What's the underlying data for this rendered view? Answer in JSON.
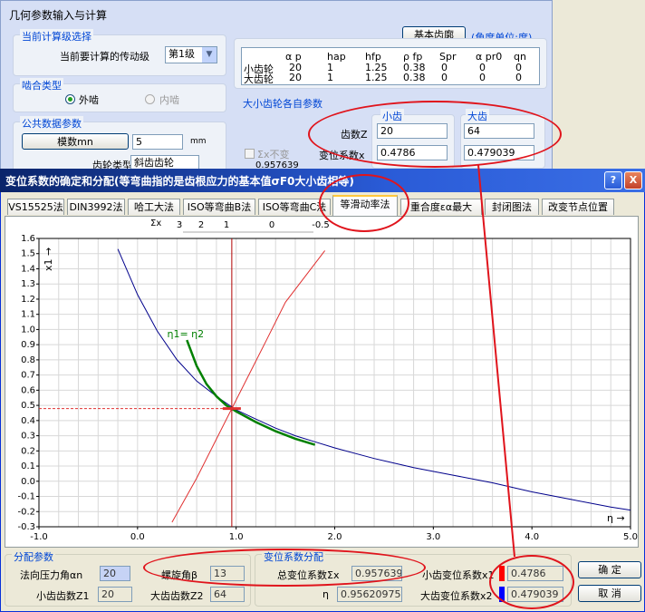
{
  "bg_window": {
    "title": "几何参数输入与计算",
    "current_stage_group": "当前计算级选择",
    "current_stage_label": "当前要计算的传动级",
    "current_stage_value": "第1级",
    "base_rack_button": "基本齿廓",
    "angle_unit": "(角度单位:度)",
    "rack_table": {
      "headers": [
        "α p",
        "hap",
        "hfp",
        "ρ fp",
        "Spr",
        "α pr0",
        "qn"
      ],
      "rows": [
        {
          "name": "小齿轮",
          "values": [
            "20",
            "1",
            "1.25",
            "0.38",
            "0",
            "0",
            "0"
          ]
        },
        {
          "name": "大齿轮",
          "values": [
            "20",
            "1",
            "1.25",
            "0.38",
            "0",
            "0",
            "0"
          ]
        }
      ]
    },
    "mesh_group": "啮合类型",
    "mesh_external": "外啮",
    "mesh_internal": "内啮",
    "common_group": "公共数据参数",
    "module_button": "模数mn",
    "module_value": "5",
    "module_unit": "mm",
    "gear_type_label": "齿轮类型",
    "gear_type_value": "斜齿齿轮",
    "gear_params_group": "大小齿轮各自参数",
    "small_gear": "小齿",
    "large_gear": "大齿",
    "teeth_label": "齿数Z",
    "teeth_small": "20",
    "teeth_large": "64",
    "shift_label": "变位系数x",
    "shift_small": "0.4786",
    "shift_large": "0.479039",
    "sum_not_change": "Σx不变",
    "sum_value": "0.957639"
  },
  "dialog": {
    "title": "变位系数的确定和分配(等弯曲指的是齿根应力的基本值σF0大小齿相等)",
    "help_button": "?",
    "close_button": "X",
    "tabs": [
      "VS15525法",
      "DIN3992法",
      "哈工大法",
      "ISO等弯曲B法",
      "ISO等弯曲C法",
      "等滑动率法",
      "重合度εα最大",
      "封闭图法",
      "改变节点位置"
    ],
    "active_tab": 5,
    "footer": {
      "dist_group": "分配参数",
      "pressure_angle_label": "法向压力角αn",
      "pressure_angle": "20",
      "helix_label": "螺旋角β",
      "helix": "13",
      "z1_label": "小齿齿数Z1",
      "z1": "20",
      "z2_label": "大齿齿数Z2",
      "z2": "64",
      "shift_group": "变位系数分配",
      "total_shift_label": "总变位系数Σx",
      "total_shift": "0.957639",
      "eta_label": "η",
      "eta": "0.956209757",
      "x1_label": "小齿变位系数x1",
      "x1": "0.4786",
      "x2_label": "大齿变位系数x2",
      "x2": "0.479039",
      "ok_button": "确  定",
      "cancel_button": "取  消"
    }
  },
  "chart_data": {
    "type": "line",
    "xlim": [
      -1.0,
      5.0
    ],
    "ylim": [
      -0.3,
      1.6
    ],
    "x_ticks": [
      "-1.0",
      "0.0",
      "1.0",
      "2.0",
      "3.0",
      "4.0",
      "5.0"
    ],
    "y_ticks": [
      "1.6",
      "1.5",
      "1.4",
      "1.3",
      "1.2",
      "1.1",
      "1.0",
      "0.9",
      "0.8",
      "0.7",
      "0.6",
      "0.5",
      "0.4",
      "0.3",
      "0.2",
      "0.1",
      "0.0",
      "-0.1",
      "-0.2",
      "-0.3"
    ],
    "xlabel": "η",
    "ylabel": "x1",
    "sum_axis_label": "Σx",
    "sum_axis_ticks": [
      "3",
      "2",
      "1",
      "0",
      "-0.5"
    ],
    "grid": true,
    "curve_annotation": "η1= η2",
    "point": {
      "x": 0.956,
      "y": 0.479
    },
    "series": [
      {
        "id": "blue",
        "color": "#00008b",
        "points": [
          [
            -0.2,
            1.53
          ],
          [
            0.0,
            1.23
          ],
          [
            0.2,
            0.99
          ],
          [
            0.4,
            0.8
          ],
          [
            0.6,
            0.66
          ],
          [
            0.8,
            0.56
          ],
          [
            1.0,
            0.47
          ],
          [
            1.2,
            0.41
          ],
          [
            1.4,
            0.35
          ],
          [
            1.6,
            0.3
          ],
          [
            1.8,
            0.26
          ],
          [
            2.0,
            0.22
          ],
          [
            2.4,
            0.15
          ],
          [
            2.8,
            0.09
          ],
          [
            3.2,
            0.04
          ],
          [
            3.6,
            -0.01
          ],
          [
            4.0,
            -0.07
          ],
          [
            4.4,
            -0.12
          ],
          [
            4.8,
            -0.17
          ],
          [
            5.0,
            -0.19
          ]
        ]
      },
      {
        "id": "green",
        "color": "#008000",
        "points": [
          [
            0.5,
            0.93
          ],
          [
            0.6,
            0.76
          ],
          [
            0.7,
            0.64
          ],
          [
            0.8,
            0.56
          ],
          [
            0.9,
            0.5
          ],
          [
            1.0,
            0.46
          ],
          [
            1.2,
            0.39
          ],
          [
            1.4,
            0.33
          ],
          [
            1.6,
            0.28
          ],
          [
            1.8,
            0.24
          ]
        ]
      },
      {
        "id": "red-diag",
        "color": "#e03030",
        "points": [
          [
            0.35,
            -0.27
          ],
          [
            0.6,
            0.02
          ],
          [
            0.956,
            0.479
          ],
          [
            1.3,
            0.92
          ],
          [
            1.5,
            1.18
          ],
          [
            1.9,
            1.52
          ]
        ]
      }
    ]
  },
  "colors": {
    "xp_title_start": "#0a246a",
    "xp_title_end": "#3a6ee5",
    "highlight_oval": "#e0141c",
    "x1_swatch": "#ff0000",
    "x2_swatch": "#0000ff"
  }
}
